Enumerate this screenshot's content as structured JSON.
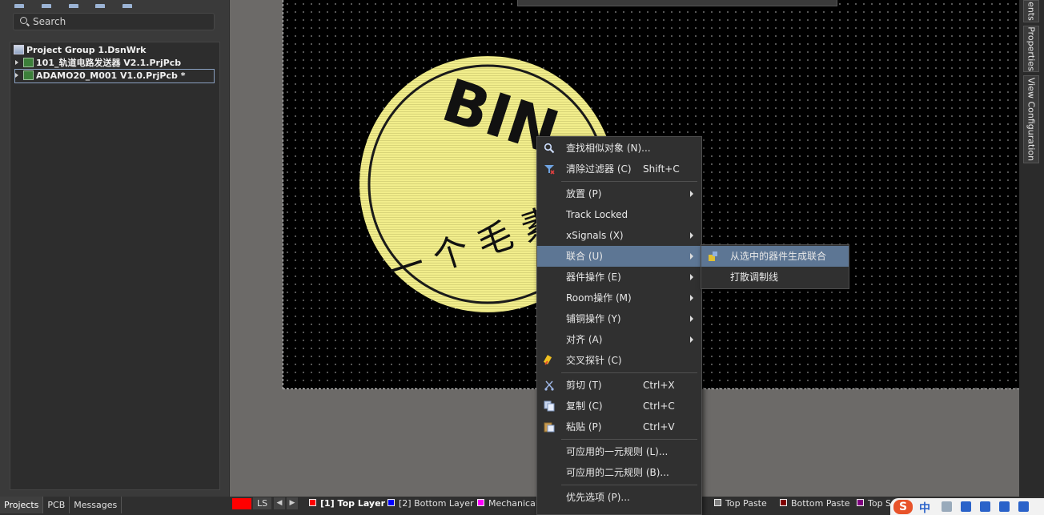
{
  "left_panel": {
    "search_placeholder": "Search",
    "tree": [
      {
        "label": "Project Group 1.DsnWrk"
      },
      {
        "label": "101_轨道电路发送器 V2.1.PrjPcb"
      },
      {
        "label": "ADAMO20_M001 V1.0.PrjPcb *"
      }
    ],
    "bottom_tabs": [
      "Projects",
      "PCB",
      "Messages"
    ]
  },
  "right_dock": {
    "tabs": [
      "ents",
      "Properties",
      "View Configuration"
    ]
  },
  "canvas": {
    "logo_text_top": "BIN",
    "logo_text_bottom": "一个毛素",
    "logo_color": "#f2ee8c"
  },
  "context_menu": {
    "items": [
      {
        "label": "查找相似对象 (N)...",
        "shortcut": "",
        "icon": "magnifier-icon"
      },
      {
        "label": "清除过滤器 (C)",
        "shortcut": "Shift+C",
        "icon": "clear-filter-icon"
      },
      {
        "label": "放置 (P)",
        "shortcut": ""
      },
      {
        "label": "Track Locked",
        "shortcut": ""
      },
      {
        "label": "xSignals (X)",
        "shortcut": ""
      },
      {
        "label": "联合 (U)",
        "shortcut": ""
      },
      {
        "label": "器件操作 (E)",
        "shortcut": ""
      },
      {
        "label": "Room操作 (M)",
        "shortcut": ""
      },
      {
        "label": "铺铜操作 (Y)",
        "shortcut": ""
      },
      {
        "label": "对齐 (A)",
        "shortcut": ""
      },
      {
        "label": "交叉探针 (C)",
        "shortcut": "",
        "icon": "cross-probe-icon"
      },
      {
        "label": "剪切 (T)",
        "shortcut": "Ctrl+X",
        "icon": "scissors-icon"
      },
      {
        "label": "复制 (C)",
        "shortcut": "Ctrl+C",
        "icon": "copy-icon"
      },
      {
        "label": "粘贴 (P)",
        "shortcut": "Ctrl+V",
        "icon": "paste-icon"
      },
      {
        "label": "可应用的一元规则 (L)...",
        "shortcut": ""
      },
      {
        "label": "可应用的二元规则 (B)...",
        "shortcut": ""
      },
      {
        "label": "优先选项 (P)...",
        "shortcut": ""
      }
    ]
  },
  "sub_menu": {
    "items": [
      {
        "label": "从选中的器件生成联合",
        "icon": "union-icon"
      },
      {
        "label": "打散调制线"
      }
    ]
  },
  "layer_bar": {
    "ls_label": "LS",
    "layers": [
      {
        "label": "[1] Top Layer",
        "color": "#ff0000"
      },
      {
        "label": "[2] Bottom Layer",
        "color": "#0000ff"
      },
      {
        "label": "Mechanical",
        "color": "#ff00ff"
      },
      {
        "label": "Top Paste",
        "color": "#808080"
      },
      {
        "label": "Bottom Paste",
        "color": "#800000"
      },
      {
        "label": "Top S",
        "color": "#800080"
      }
    ]
  },
  "ime": {
    "logo": "S",
    "lang": "中"
  }
}
